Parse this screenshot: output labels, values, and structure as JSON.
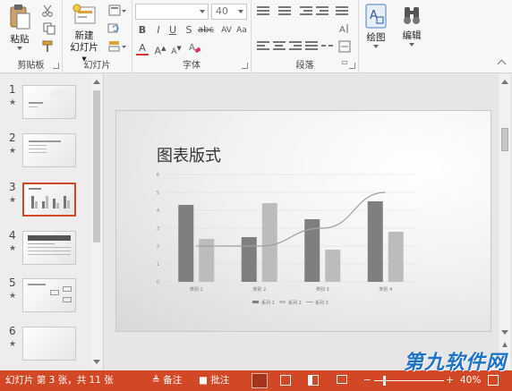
{
  "ribbon": {
    "clipboard": {
      "paste": "粘贴",
      "group": "剪贴板"
    },
    "slides": {
      "new_slide_line1": "新建",
      "new_slide_line2": "幻灯片",
      "group": "幻灯片"
    },
    "font": {
      "size": "40",
      "group": "字体"
    },
    "paragraph": {
      "group": "段落"
    },
    "drawing": {
      "label": "绘图"
    },
    "editing": {
      "label": "编辑"
    }
  },
  "thumbnails": [
    {
      "num": "1",
      "star": "★"
    },
    {
      "num": "2",
      "star": "★"
    },
    {
      "num": "3",
      "star": "★"
    },
    {
      "num": "4",
      "star": "★"
    },
    {
      "num": "5",
      "star": "★"
    },
    {
      "num": "6",
      "star": "★"
    }
  ],
  "slide": {
    "title": "图表版式"
  },
  "chart_data": {
    "type": "bar",
    "categories": [
      "类别 1",
      "类别 2",
      "类别 3",
      "类别 4"
    ],
    "series": [
      {
        "name": "系列 1",
        "values": [
          4.3,
          2.5,
          3.5,
          4.5
        ],
        "color": "#7f7f7f",
        "kind": "bar"
      },
      {
        "name": "系列 2",
        "values": [
          2.4,
          4.4,
          1.8,
          2.8
        ],
        "color": "#bcbcbc",
        "kind": "bar"
      },
      {
        "name": "系列 3",
        "values": [
          2,
          2,
          3,
          5
        ],
        "color": "#a0a0a0",
        "kind": "line"
      }
    ],
    "yticks": [
      "0",
      "1",
      "2",
      "3",
      "4",
      "5",
      "6"
    ],
    "ylim": [
      0,
      6
    ],
    "legend": "bottom"
  },
  "status": {
    "slide_info": "幻灯片 第 3 张，共 11 张",
    "notes": "备注",
    "comments": "批注",
    "zoom": "40%",
    "watermark": "第九软件网"
  }
}
